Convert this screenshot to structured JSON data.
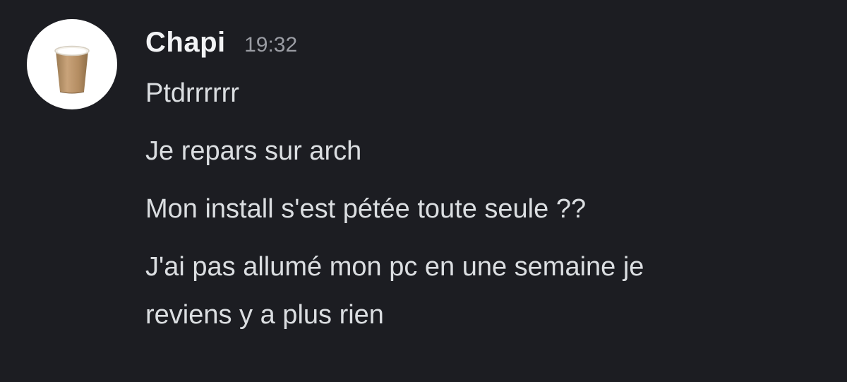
{
  "message": {
    "username": "Chapi",
    "timestamp": "19:32",
    "avatar_icon": "paper-cup-icon",
    "lines": [
      "Ptdrrrrrr",
      "Je repars sur arch",
      "Mon install s'est pétée toute seule ??",
      "J'ai pas allumé mon pc en une semaine je",
      "reviens y a plus rien"
    ]
  },
  "colors": {
    "background": "#1c1d22",
    "username": "#f2f3f5",
    "timestamp": "#9a9ca3",
    "text": "#dbdee1"
  }
}
